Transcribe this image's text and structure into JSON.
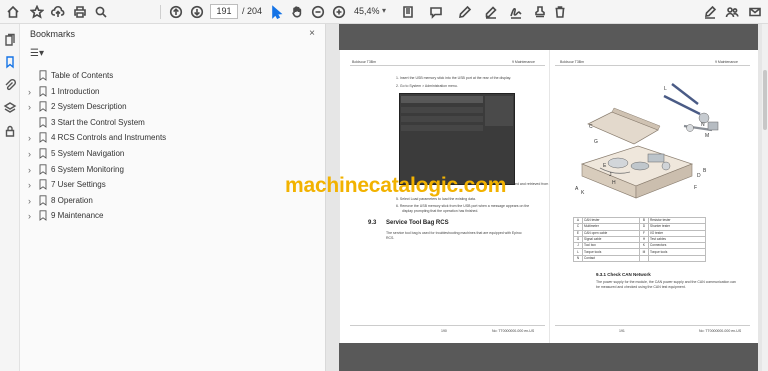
{
  "toolbar": {
    "page_current": "191",
    "page_total": "/ 204",
    "zoom": "45,4%"
  },
  "bookmarks": {
    "title": "Bookmarks",
    "close": "×",
    "menu_label": "☰▾",
    "items": [
      {
        "label": "Table of Contents",
        "expandable": false
      },
      {
        "label": "1 Introduction",
        "expandable": true
      },
      {
        "label": "2 System Description",
        "expandable": true
      },
      {
        "label": "3 Start the Control System",
        "expandable": false
      },
      {
        "label": "4 RCS Controls and Instruments",
        "expandable": true
      },
      {
        "label": "5 System Navigation",
        "expandable": true
      },
      {
        "label": "6 System Monitoring",
        "expandable": true
      },
      {
        "label": "7 User Settings",
        "expandable": true
      },
      {
        "label": "8 Operation",
        "expandable": true
      },
      {
        "label": "9 Maintenance",
        "expandable": true
      }
    ]
  },
  "document": {
    "left_page": {
      "header_left": "Boldsour T3Bm",
      "header_right": "9 Maintenance",
      "step1": "1.   Insert the USB memory stick into the USB port at the rear of the display.",
      "step2": "2.   Go to System > Administration menu.",
      "step_fragment": "ed and retrieved from",
      "step_fragment2": "ort.",
      "step5": "5.   Select Load parameters to load the existing data.",
      "step6": "6.   Remove the USB memory stick from the USB port when a message appears on the",
      "step6b": "display prompting that the operation has finished.",
      "section_num": "9.3",
      "section_title": "Service Tool Bag RCS",
      "section_text": "The service tool bag is used for troubleshooting machines that are equipped with Epiroc",
      "section_text2": "RCS.",
      "footer_page": "190",
      "footer_doc": "No: TT0000000-000 en-US"
    },
    "right_page": {
      "header_left": "Boldsour T3Bm",
      "header_right": "9 Maintenance",
      "callouts": [
        "A",
        "B",
        "C",
        "D",
        "E",
        "F",
        "G",
        "H",
        "J",
        "K",
        "L",
        "M",
        "N"
      ],
      "subsection": "9.3.1 Check CAN Network",
      "sub_text": "The power supply for the module, the CAN power supply and the CAN communication can",
      "sub_text2": "be measured and checked using the CAN test equipment.",
      "footer_page": "191",
      "footer_doc": "No: TT0000000-000 en-US"
    },
    "parts_table": [
      [
        "A",
        "CAN tester",
        "B",
        "Resistor tester"
      ],
      [
        "C",
        "Multimeter",
        "D",
        "Shunter tester"
      ],
      [
        "E",
        "CAN open cable",
        "F",
        "I/O tester"
      ],
      [
        "G",
        "Signal cable",
        "H",
        "Test cables"
      ],
      [
        "J",
        "Tool box",
        "K",
        "Connectors"
      ],
      [
        "L",
        "Torque tools",
        "M",
        "Torque tools"
      ],
      [
        "N",
        "Contact",
        "",
        ""
      ]
    ]
  },
  "watermark": "machinecatalogic.com",
  "colors": {
    "accent": "#1473e6",
    "watermark": "#f2b200",
    "strip": "#595959"
  }
}
